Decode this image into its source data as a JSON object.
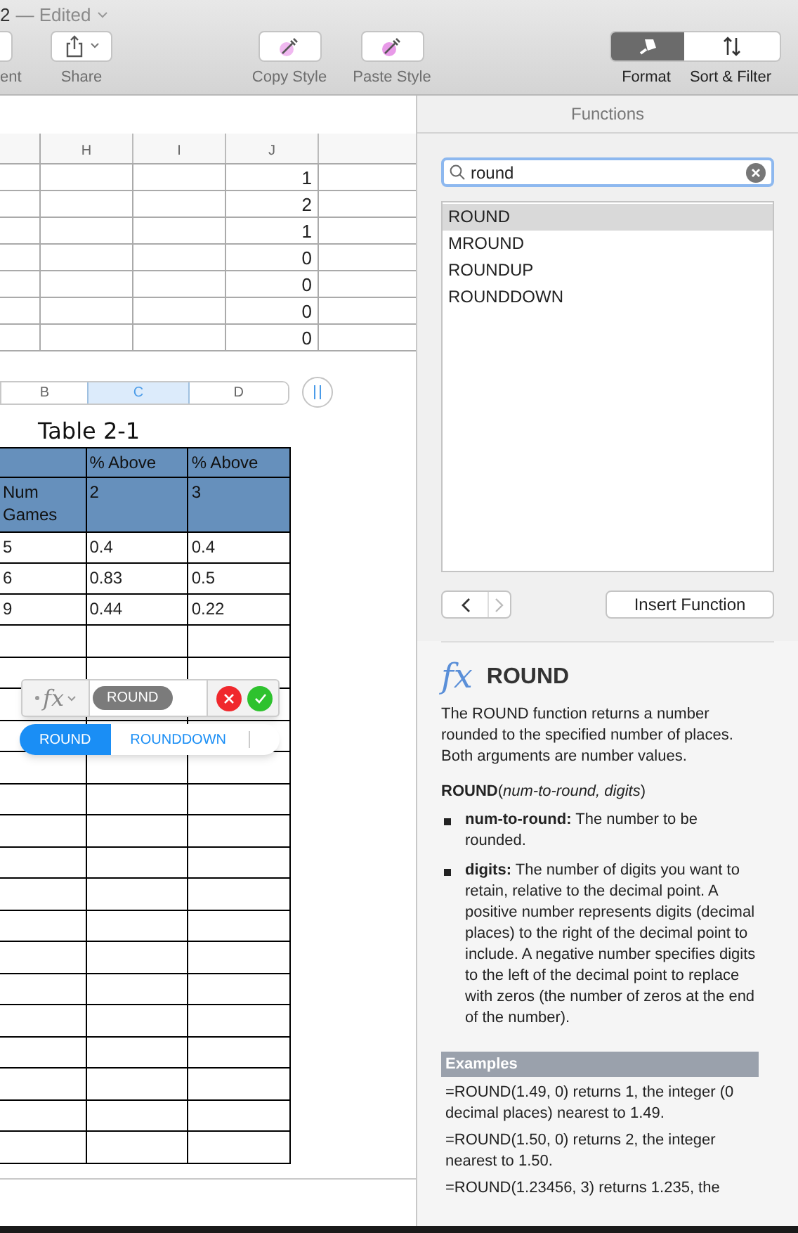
{
  "window": {
    "title": "2",
    "status": "— Edited"
  },
  "toolbar": {
    "buttons": [
      {
        "kind": "blank",
        "label": "ent"
      },
      {
        "kind": "share",
        "label": "Share"
      },
      {
        "kind": "copy",
        "label": "Copy Style"
      },
      {
        "kind": "paste",
        "label": "Paste Style"
      }
    ],
    "segments": [
      {
        "kind": "format",
        "label": "Format",
        "selected": true
      },
      {
        "kind": "sort",
        "label": "Sort & Filter",
        "selected": false
      }
    ]
  },
  "upper_table": {
    "columns": [
      "H",
      "I",
      "J"
    ],
    "column_j_values": [
      "1",
      "2",
      "1",
      "0",
      "0",
      "0",
      "0"
    ]
  },
  "column_tabs": [
    {
      "label": "B",
      "selected": false
    },
    {
      "label": "C",
      "selected": true
    },
    {
      "label": "D",
      "selected": false
    }
  ],
  "table": {
    "title": "Table 2-1",
    "header_rows": [
      [
        "",
        "% Above",
        "% Above"
      ],
      [
        "Num Games",
        "2",
        "3"
      ]
    ],
    "rows": [
      [
        "5",
        "0.4",
        "0.4"
      ],
      [
        "6",
        "0.83",
        "0.5"
      ],
      [
        "9",
        "0.44",
        "0.22"
      ]
    ]
  },
  "formula_editor": {
    "prefix": "fx",
    "token": "ROUND",
    "suggestions": [
      {
        "label": "ROUND",
        "selected": true
      },
      {
        "label": "ROUNDDOWN",
        "selected": false
      }
    ]
  },
  "functions_panel": {
    "title": "Functions",
    "search": {
      "value": "round"
    },
    "results": [
      {
        "label": "ROUND",
        "selected": true
      },
      {
        "label": "MROUND",
        "selected": false
      },
      {
        "label": "ROUNDUP",
        "selected": false
      },
      {
        "label": "ROUNDDOWN",
        "selected": false
      }
    ],
    "insert_button": "Insert Function",
    "detail": {
      "icon": "fx",
      "name": "ROUND",
      "description": "The ROUND function returns a number rounded to the specified number of places. Both arguments are number values.",
      "syntax": "**ROUND**(*num-to-round, digits*)",
      "arguments": [
        {
          "name": "num-to-round:",
          "text": "The number to be rounded."
        },
        {
          "name": "digits:",
          "text": "The number of digits you want to retain, relative to the decimal point. A positive number represents digits (decimal places) to the right of the decimal point to include. A negative number specifies digits to the left of the decimal point to replace with zeros (the number of zeros at the end of the number)."
        }
      ],
      "examples_heading": "Examples",
      "examples": [
        "=ROUND(1.49, 0) returns 1, the integer (0 decimal places) nearest to 1.49.",
        "=ROUND(1.50, 0) returns 2, the integer nearest to 1.50.",
        "=ROUND(1.23456, 3) returns 1.235, the"
      ]
    }
  }
}
